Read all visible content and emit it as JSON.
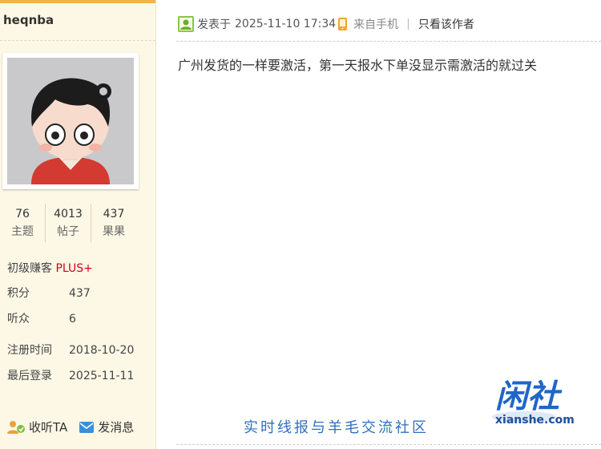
{
  "user": {
    "name": "heqnba",
    "stats": [
      {
        "value": "76",
        "label": "主题"
      },
      {
        "value": "4013",
        "label": "帖子"
      },
      {
        "value": "437",
        "label": "果果"
      }
    ],
    "level": "初级赚客",
    "level_badge": "PLUS+",
    "info": [
      {
        "key": "积分",
        "value": "437"
      },
      {
        "key": "听众",
        "value": "6"
      },
      {
        "key": "注册时间",
        "value": "2018-10-20"
      },
      {
        "key": "最后登录",
        "value": "2025-11-11"
      }
    ],
    "actions": {
      "follow": "收听TA",
      "message": "发消息"
    }
  },
  "post": {
    "posted_prefix": "发表于",
    "posted_time": "2025-11-10 17:34",
    "source": "来自手机",
    "only_author": "只看该作者",
    "body": "广州发货的一样要激活，第一天报水下单没显示需激活的就过关"
  },
  "watermark": {
    "slogan": "实时线报与羊毛交流社区",
    "logo_text": "闲社",
    "logo_domain": "xianshe.com"
  },
  "colors": {
    "accent": "#f2b34a",
    "plus": "#d0021b",
    "watermark": "#2e6fbf"
  }
}
